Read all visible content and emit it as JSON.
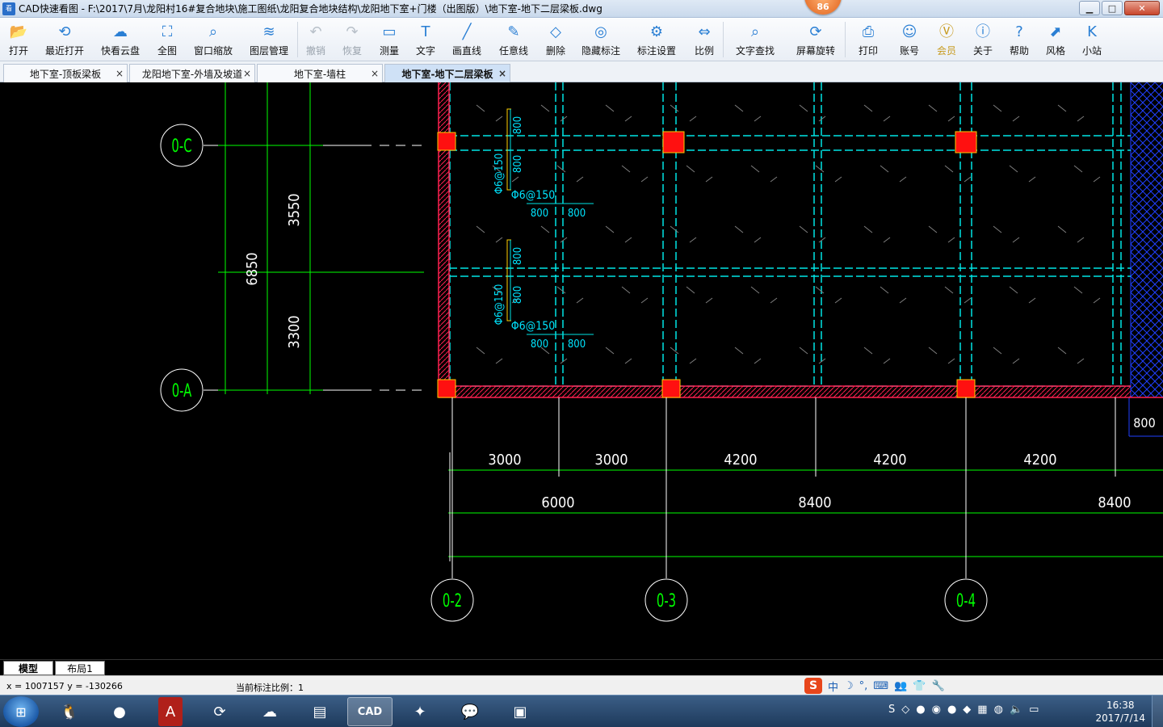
{
  "window": {
    "title": "CAD快速看图 - F:\\2017\\7月\\龙阳村16#复合地块\\施工图纸\\龙阳复合地块结构\\龙阳地下室+门楼（出图版）\\地下室-地下二层梁板.dwg",
    "badge": "86",
    "minimize": "▁",
    "maximize": "□",
    "close": "✕"
  },
  "toolbar": {
    "items": [
      {
        "label": "打开",
        "icon": "folder-icon"
      },
      {
        "label": "最近打开",
        "icon": "history-icon"
      },
      {
        "label": "快看云盘",
        "icon": "cloud-icon"
      },
      {
        "label": "全图",
        "icon": "fullview-icon"
      },
      {
        "label": "窗口缩放",
        "icon": "zoom-window-icon"
      },
      {
        "label": "图层管理",
        "icon": "layers-icon"
      },
      {
        "label": "撤销",
        "icon": "undo-icon"
      },
      {
        "label": "恢复",
        "icon": "redo-icon"
      },
      {
        "label": "测量",
        "icon": "ruler-icon"
      },
      {
        "label": "文字",
        "icon": "text-icon"
      },
      {
        "label": "画直线",
        "icon": "line-icon"
      },
      {
        "label": "任意线",
        "icon": "pen-icon"
      },
      {
        "label": "删除",
        "icon": "eraser-icon"
      },
      {
        "label": "隐藏标注",
        "icon": "eye-hide-icon"
      },
      {
        "label": "标注设置",
        "icon": "annotation-settings-icon"
      },
      {
        "label": "比例",
        "icon": "scale-icon"
      },
      {
        "label": "文字查找",
        "icon": "find-text-icon"
      },
      {
        "label": "屏幕旋转",
        "icon": "rotate-icon"
      },
      {
        "label": "打印",
        "icon": "printer-icon"
      },
      {
        "label": "账号",
        "icon": "user-icon"
      },
      {
        "label": "会员",
        "icon": "vip-icon"
      },
      {
        "label": "关于",
        "icon": "info-icon"
      },
      {
        "label": "帮助",
        "icon": "help-icon"
      },
      {
        "label": "风格",
        "icon": "style-icon"
      },
      {
        "label": "小站",
        "icon": "station-icon"
      }
    ]
  },
  "tabs": [
    {
      "label": "地下室-顶板梁板",
      "close": "×"
    },
    {
      "label": "龙阳地下室-外墙及坡道",
      "close": "×"
    },
    {
      "label": "地下室-墙柱",
      "close": "×"
    },
    {
      "label": "地下室-地下二层梁板",
      "close": "×"
    }
  ],
  "drawing": {
    "axis_bubbles": [
      "0-C",
      "0-A",
      "0-2",
      "0-3",
      "0-4"
    ],
    "dims_vertical": [
      "6850",
      "3550",
      "3300"
    ],
    "dims_row1": [
      "3000",
      "3000",
      "4200",
      "4200",
      "4200"
    ],
    "dims_row2": [
      "6000",
      "8400",
      "8400"
    ],
    "dim_right": "800",
    "rebar": [
      "Φ6@150",
      "Φ6@150",
      "Φ6@150",
      "Φ6@150"
    ],
    "rebar_small": [
      "800",
      "800",
      "800",
      "800",
      "800",
      "800",
      "800",
      "800"
    ],
    "colors": {
      "grid": "#00ff00",
      "axis": "#00e5e5",
      "wall": "#ff2050",
      "column": "#ff1010",
      "hatch": "#2040ff",
      "rebar": "#00e5ff",
      "bracket": "#ffd000"
    }
  },
  "layout_tabs": [
    "模型",
    "布局1"
  ],
  "status": {
    "coord": "x = 1007157  y = -130266",
    "scale": "当前标注比例：1",
    "ime_items": [
      "中",
      "☽",
      "°,",
      "⌨",
      "👥",
      "👕",
      "🔧"
    ]
  },
  "taskbar": {
    "apps": [
      "qq-icon",
      "pdf-icon",
      "refresh-icon",
      "baidu-cloud-icon",
      "explorer-icon",
      "cad-icon",
      "network-icon",
      "wechat-icon",
      "contacts-icon"
    ],
    "cad_label": "CAD",
    "time": "16:38",
    "date": "2017/7/14"
  }
}
